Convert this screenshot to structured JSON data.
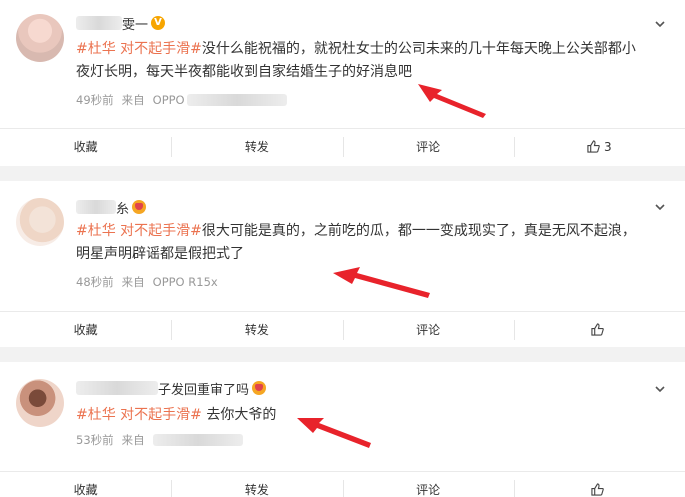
{
  "posts": [
    {
      "username_visible": "雯一",
      "badge": "V",
      "hashtag": "#杜华 对不起手滑#",
      "text": "没什么能祝福的，就祝杜女士的公司未来的几十年每天晚上公关部都小夜灯长明，每天半夜都能收到自家结婚生子的好消息吧",
      "time": "49秒前",
      "source_prefix": "来自",
      "source": "OPPO",
      "actions": {
        "collect": "收藏",
        "repost": "转发",
        "comment": "评论",
        "like_count": "3"
      }
    },
    {
      "username_visible": "糸",
      "badge": "crown",
      "hashtag": "#杜华 对不起手滑#",
      "text": "很大可能是真的，之前吃的瓜，都一一变成现实了，真是无风不起浪，明星声明辟谣都是假把式了",
      "time": "48秒前",
      "source_prefix": "来自",
      "source": "OPPO R15x",
      "actions": {
        "collect": "收藏",
        "repost": "转发",
        "comment": "评论",
        "like_count": ""
      }
    },
    {
      "username_visible": "子发回重审了吗",
      "badge": "crown",
      "hashtag": "#杜华 对不起手滑#",
      "text": " 去你大爷的",
      "time": "53秒前",
      "source_prefix": "来自",
      "source": "",
      "actions": {
        "collect": "收藏",
        "repost": "转发",
        "comment": "评论",
        "like_count": ""
      }
    }
  ],
  "icons": {
    "chevron": "chevron-down-icon",
    "like": "thumbs-up-icon",
    "arrow": "red-arrow-annotation"
  },
  "colors": {
    "hashtag": "#eb7350",
    "arrow": "#e8232b",
    "meta": "#999999",
    "badge_v": "#f7a500"
  }
}
